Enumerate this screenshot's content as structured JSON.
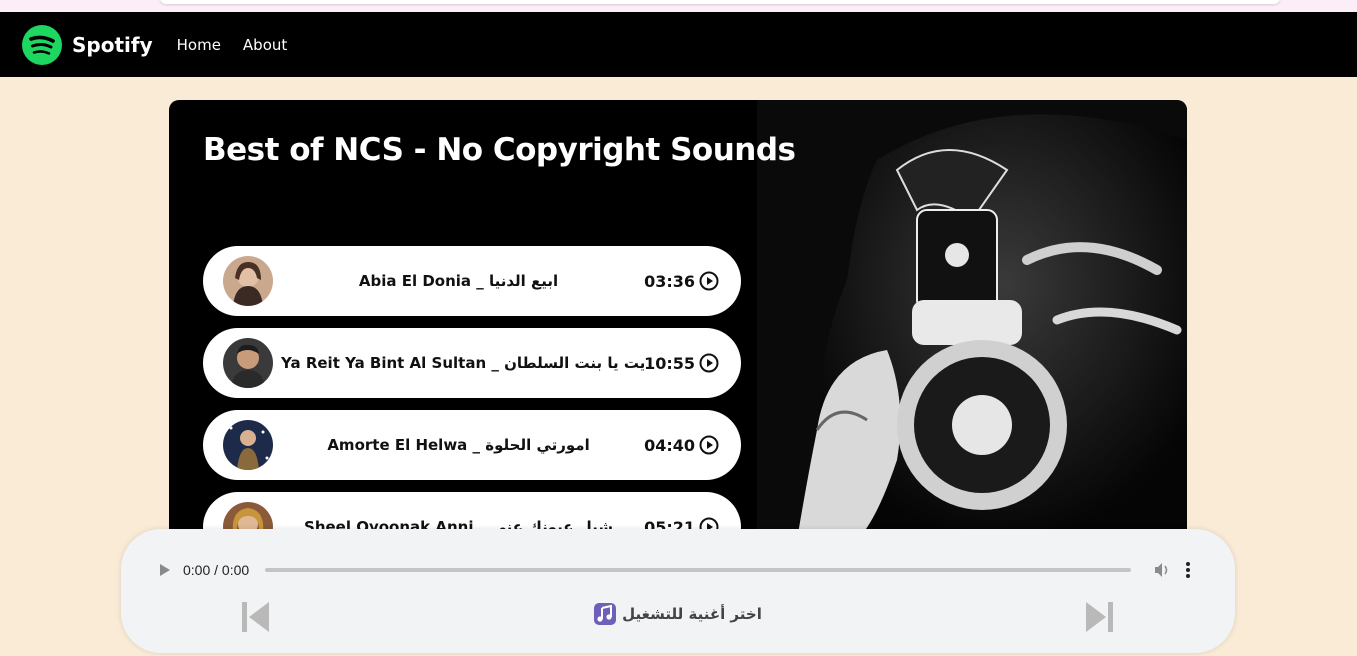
{
  "nav": {
    "brand": "Spotify",
    "links": [
      "Home",
      "About"
    ]
  },
  "main": {
    "title": "Best of NCS - No Copyright Sounds",
    "songs": [
      {
        "name": "Abia El Donia _ ابيع الدنيا",
        "duration": "03:36"
      },
      {
        "name": "Ya Reit Ya Bint Al Sultan _ يا ريت يا بنت السلطان",
        "duration": "10:55"
      },
      {
        "name": "Amorte El Helwa _ امورتي الحلوة",
        "duration": "04:40"
      },
      {
        "name": "Sheel Oyoonak Anni _ شيل عيونك عني",
        "duration": "05:21"
      }
    ]
  },
  "player": {
    "time": "0:00 / 0:00",
    "progress": 0,
    "now_playing": "اختر أغنية للتشغيل"
  },
  "colors": {
    "page_bg": "#faebd7",
    "navbar_bg": "#000000",
    "brand_green": "#1ed760",
    "player_bg": "#f1f3f4"
  }
}
